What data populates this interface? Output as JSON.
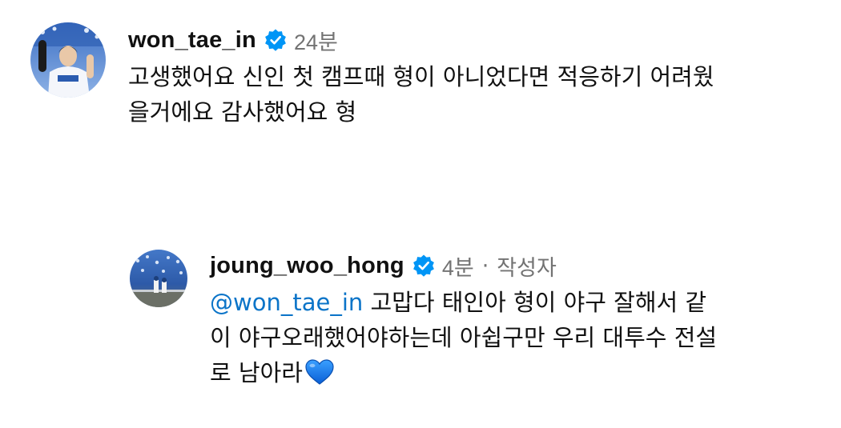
{
  "comments": [
    {
      "username": "won_tae_in",
      "time": "24분",
      "lines": [
        "고생했어요 신인 첫 캠프때 형이 아니었다면 적응하기 어려웠",
        "을거에요 감사했어요 형"
      ]
    }
  ],
  "reply": {
    "username": "joung_woo_hong",
    "time": "4분",
    "separator": "·",
    "author_tag": "작성자",
    "mention": "@won_tae_in",
    "line1_rest": " 고맙다 태인아 형이 야구 잘해서 같",
    "line2": "이 야구오래했어야하는데 아쉽구만 우리 대투수 전설",
    "line3": "로 남아라"
  },
  "icons": {
    "verified": "verified-badge-icon",
    "heart": "blue-heart-emoji"
  },
  "colors": {
    "verified_blue": "#0095f6",
    "mention_blue": "#0b74c8",
    "muted_gray": "#737373"
  }
}
